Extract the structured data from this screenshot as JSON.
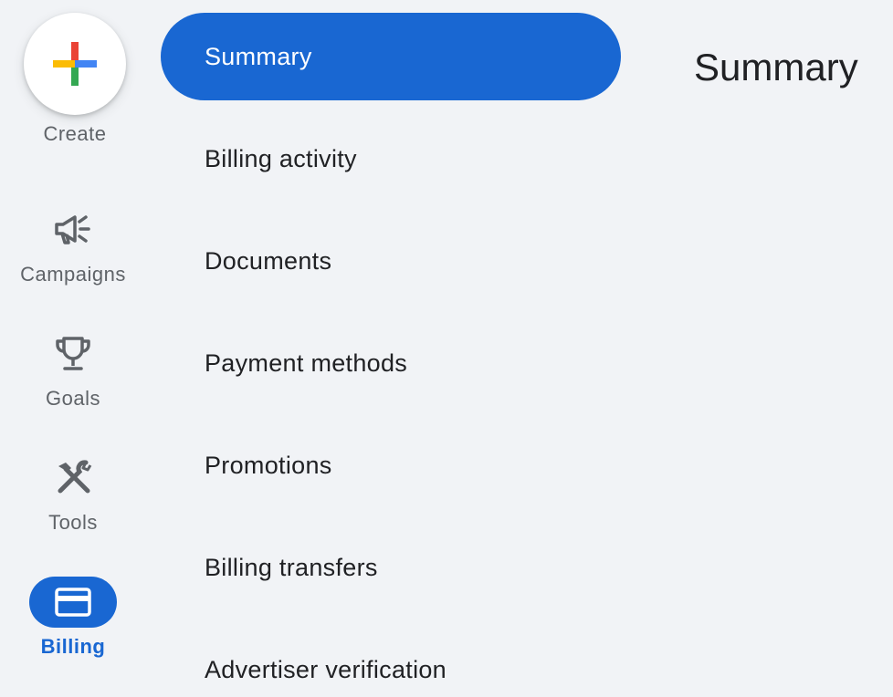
{
  "rail": {
    "create": {
      "label": "Create",
      "icon": "plus-multicolor-icon"
    },
    "items": [
      {
        "label": "Campaigns",
        "icon": "megaphone-icon",
        "active": false
      },
      {
        "label": "Goals",
        "icon": "trophy-icon",
        "active": false
      },
      {
        "label": "Tools",
        "icon": "tools-icon",
        "active": false
      },
      {
        "label": "Billing",
        "icon": "credit-card-icon",
        "active": true
      }
    ]
  },
  "nav": {
    "items": [
      {
        "label": "Summary",
        "active": true
      },
      {
        "label": "Billing activity",
        "active": false
      },
      {
        "label": "Documents",
        "active": false
      },
      {
        "label": "Payment methods",
        "active": false
      },
      {
        "label": "Promotions",
        "active": false
      },
      {
        "label": "Billing transfers",
        "active": false
      },
      {
        "label": "Advertiser verification",
        "active": false
      }
    ]
  },
  "page": {
    "title": "Summary"
  },
  "colors": {
    "background": "#f1f3f6",
    "accent": "#1967d2",
    "text": "#202124",
    "muted": "#5f6368",
    "google_red": "#ea4335",
    "google_blue": "#4285f4",
    "google_yellow": "#fbbc04",
    "google_green": "#34a853"
  }
}
